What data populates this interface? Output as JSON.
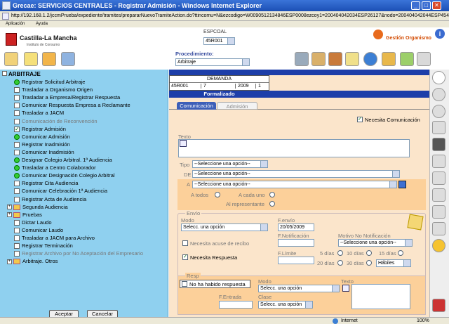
{
  "window": {
    "title": "Grecae: SERVICIOS CENTRALES - Registrar Admisión - Windows Internet Explorer",
    "address": "http://192.168.1.2/jccmPrueba/expediente/tramites/prepararNuevoTramiteAction.do?ttincomu=N&ezcodigo=W0090512134846ESP0008ezcoy1=200404042034ESP26127&nodo=200404042044ESP4541:"
  },
  "menu": [
    "Aplicación",
    "Ayuda"
  ],
  "header": {
    "logo_name": "Castilla-La Mancha",
    "logo_sub": "Instituto de Consumo",
    "espcoal_label": "ESPCOAL",
    "espcoal_value": "45R001",
    "gestion_label": "Gestión Organismo",
    "procedimiento_label": "Procedimiento:",
    "procedimiento_value": "Arbitraje"
  },
  "tree": {
    "root": "ARBITRAJE",
    "items": [
      {
        "label": "Registrar Solicitud Arbitraje",
        "icon": "ok",
        "gray": false
      },
      {
        "label": "Trasladar a Organismo Origen",
        "icon": "cb",
        "gray": false
      },
      {
        "label": "Trasladar a Empresa/Registrar Respuesta",
        "icon": "cb",
        "gray": false
      },
      {
        "label": "Comunicar Respuesta Empresa a Reclamante",
        "icon": "cb",
        "gray": false
      },
      {
        "label": "Trasladar a JACM",
        "icon": "cb",
        "gray": false
      },
      {
        "label": "Comunicación de Reconvención",
        "icon": "cb",
        "gray": true
      },
      {
        "label": "Registrar Admisión",
        "icon": "check",
        "gray": false
      },
      {
        "label": "Comunicar Admisión",
        "icon": "ok",
        "gray": false
      },
      {
        "label": "Registrar Inadmisión",
        "icon": "cb",
        "gray": false
      },
      {
        "label": "Comunicar Inadmisión",
        "icon": "cb",
        "gray": false
      },
      {
        "label": "Designar Colegio Arbitral. 1ª Audiencia",
        "icon": "ok",
        "gray": false
      },
      {
        "label": "Trasladar a Centro Colaborador",
        "icon": "ok",
        "gray": false
      },
      {
        "label": "Comunicar Designación Colegio Arbitral",
        "icon": "ok",
        "gray": false
      },
      {
        "label": "Registrar Cita Audiencia",
        "icon": "cb",
        "gray": false
      },
      {
        "label": "Comunicar Celebración 1ª Audiencia",
        "icon": "cb",
        "gray": false
      },
      {
        "label": "Registrar Acta de Audiencia",
        "icon": "cb",
        "gray": false
      },
      {
        "label": "Segunda Audiencia",
        "icon": "folder",
        "gray": false
      },
      {
        "label": "Pruebas",
        "icon": "folder",
        "gray": false
      },
      {
        "label": "Dictar Laudo",
        "icon": "cb",
        "gray": false
      },
      {
        "label": "Comunicar Laudo",
        "icon": "cb",
        "gray": false
      },
      {
        "label": "Trasladar a JACM para Archivo",
        "icon": "cb",
        "gray": false
      },
      {
        "label": "Registrar Terminación",
        "icon": "cb",
        "gray": false
      },
      {
        "label": "Registrar Archivo por No Aceptación del Empresario",
        "icon": "cb",
        "gray": true
      },
      {
        "label": "Arbitraje. Otros",
        "icon": "folder",
        "gray": false
      }
    ],
    "accept": "Aceptar",
    "cancel": "Cancelar"
  },
  "demanda": {
    "title": "DEMANDA",
    "cells": [
      "45R001",
      "7",
      "2009",
      "1"
    ],
    "status": "Formalizado"
  },
  "tabs": [
    "Comunicación",
    "Admisión"
  ],
  "form": {
    "necesita_com": "Necesita Comunicación",
    "texto": "Texto",
    "tipo": "Tipo",
    "tipo_val": "--Seleccione una opción--",
    "de": "DE",
    "de_val": "--Seleccione una opción--",
    "a": "A",
    "a_val": "--Seleccione una opción--",
    "a_todos": "A todos",
    "a_cada_uno": "A cada uno",
    "a_representante": "Al representante",
    "envio": "Envío",
    "modo": "Modo",
    "modo_val": "Selecc. una opción",
    "fenvio": "F.envío",
    "fenvio_val": "20/05/2009",
    "necesita_acuse": "Necesita acuse de recibo",
    "fnotif": "F.Notificación",
    "motivo": "Motivo No Notificación",
    "motivo_val": "--Seleccione una opción--",
    "necesita_resp": "Necesita Respuesta",
    "flimite": "F.Límite",
    "d5": "5 días",
    "d10": "10 días",
    "d15": "15 días",
    "d20": "20 días",
    "d30": "30 días",
    "habiles": "Hábiles",
    "resp": "Resp",
    "no_resp": "No ha habido respuesta",
    "modo2": "Modo",
    "modo2_val": "Selecc. una opción",
    "fentrada": "F.Entrada",
    "clase": "Clase",
    "clase_val": "Selecc. una opción",
    "texto2": "Texto"
  },
  "status": {
    "zone": "Internet",
    "zoom": "100%"
  }
}
